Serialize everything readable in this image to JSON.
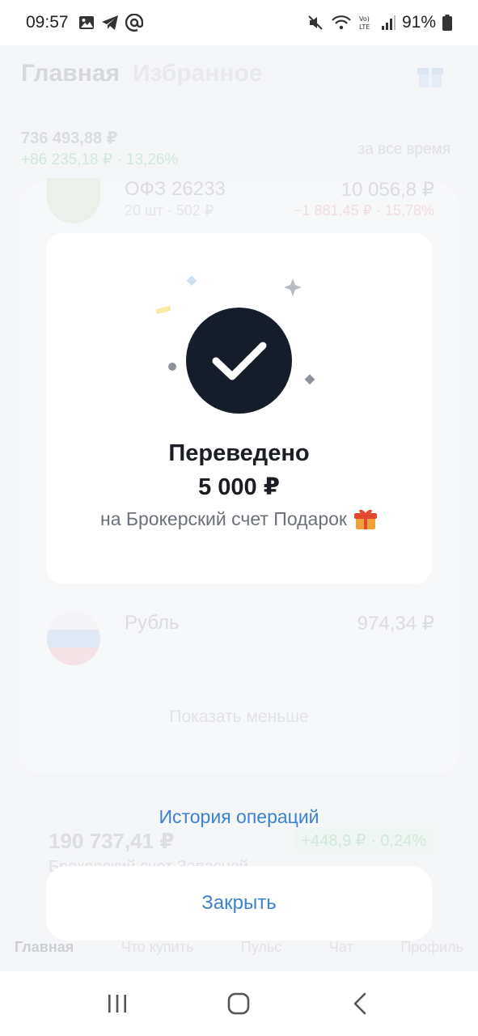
{
  "status_bar": {
    "time": "09:57",
    "battery": "91%"
  },
  "background": {
    "tab_active": "Главная",
    "tab_inactive": "Избранное",
    "total_value": "736 493,88 ₽",
    "total_change": "+86 235,18 ₽ · 13,26%",
    "period": "за все время",
    "ofz_name": "ОФЗ 26233",
    "ofz_qty": "20 шт · 502 ₽",
    "ofz_value": "10 056,8 ₽",
    "ofz_change": "−1 881,45 ₽ · 15,78%",
    "rub_name": "Рубль",
    "rub_value": "974,34 ₽",
    "show_less": "Показать меньше",
    "account_value": "190 737,41 ₽",
    "account_change": "+448,9 ₽ · 0,24%",
    "account_name": "Брокерский счет Запасной",
    "tabs": [
      "Главная",
      "Что купить",
      "Пульс",
      "Чат",
      "Профиль"
    ]
  },
  "modal": {
    "title": "Переведено",
    "amount": "5 000 ₽",
    "subtitle": "на Брокерский счет Подарок",
    "subtitle_icon": "gift-icon"
  },
  "history_link": "История операций",
  "close_button": "Закрыть",
  "colors": {
    "accent": "#3b82d0",
    "check_bg": "#151d2a"
  }
}
